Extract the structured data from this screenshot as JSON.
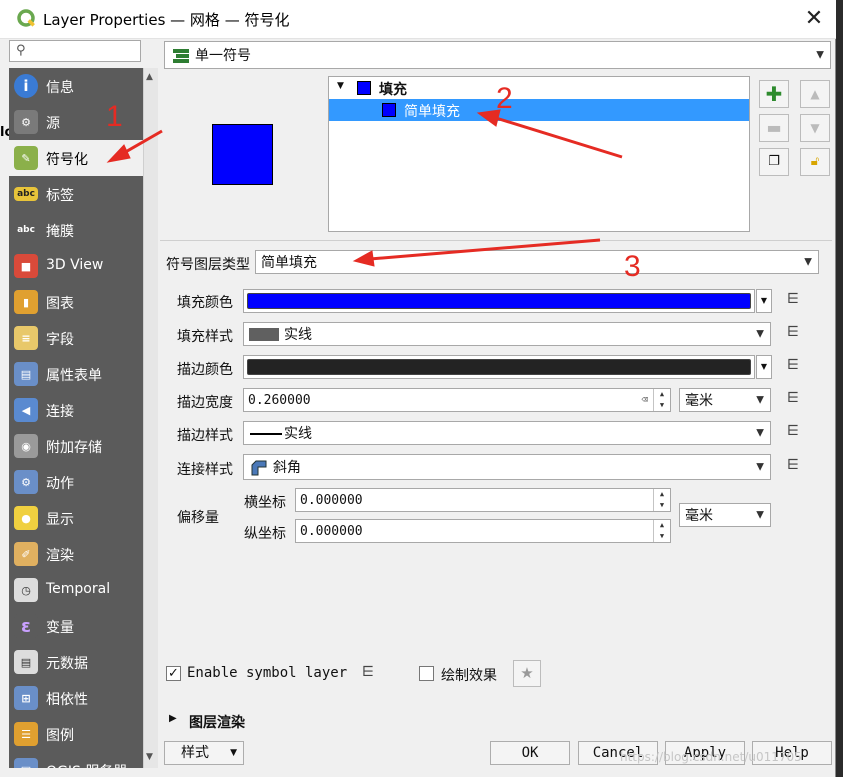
{
  "window": {
    "title": "Layer Properties — 网格 — 符号化",
    "close_glyph": "✕"
  },
  "sidebar": {
    "search_placeholder": "",
    "edge_label": "lo",
    "items": [
      {
        "label": "信息",
        "icon": "info-icon",
        "color": "#3a7bd5"
      },
      {
        "label": "源",
        "icon": "wrench-icon",
        "color": "#7a7a7a"
      },
      {
        "label": "符号化",
        "icon": "paintbrush-icon",
        "color": "#8bb04a"
      },
      {
        "label": "标签",
        "icon": "abc-label-icon",
        "color": "#e8c43a"
      },
      {
        "label": "掩膜",
        "icon": "abc-mask-icon",
        "color": "#5b5b5b"
      },
      {
        "label": "3D View",
        "icon": "cube-icon",
        "color": "#d94a3a"
      },
      {
        "label": "图表",
        "icon": "chart-icon",
        "color": "#e0a030"
      },
      {
        "label": "字段",
        "icon": "fields-icon",
        "color": "#e8c86a"
      },
      {
        "label": "属性表单",
        "icon": "form-icon",
        "color": "#6a8fc8"
      },
      {
        "label": "连接",
        "icon": "join-icon",
        "color": "#5a8ad0"
      },
      {
        "label": "附加存储",
        "icon": "database-icon",
        "color": "#9a9a9a"
      },
      {
        "label": "动作",
        "icon": "gear-action-icon",
        "color": "#6a8fc8"
      },
      {
        "label": "显示",
        "icon": "speech-bubble-icon",
        "color": "#f0d040"
      },
      {
        "label": "渲染",
        "icon": "brush-icon",
        "color": "#e0b060"
      },
      {
        "label": "Temporal",
        "icon": "clock-icon",
        "color": "#dddddd"
      },
      {
        "label": "变量",
        "icon": "epsilon-icon",
        "color": "#5b5b5b"
      },
      {
        "label": "元数据",
        "icon": "document-icon",
        "color": "#dddddd"
      },
      {
        "label": "相依性",
        "icon": "dependency-icon",
        "color": "#6a8fc8"
      },
      {
        "label": "图例",
        "icon": "legend-icon",
        "color": "#e0a030"
      },
      {
        "label": "QGIS 服务器",
        "icon": "server-icon",
        "color": "#6a8fc8"
      }
    ],
    "active_index": 2
  },
  "renderer": {
    "label": "单一符号"
  },
  "symbol_tree": {
    "rows": [
      {
        "label": "填充",
        "expand": "▼"
      },
      {
        "label": "简单填充"
      }
    ]
  },
  "layer_type": {
    "label": "符号图层类型",
    "value": "简单填充"
  },
  "props": {
    "fill_color": {
      "label": "填充颜色",
      "color": "#0000ff"
    },
    "fill_style": {
      "label": "填充样式",
      "value": "实线",
      "swatch": "#606060"
    },
    "stroke_color": {
      "label": "描边颜色",
      "color": "#232323"
    },
    "stroke_width": {
      "label": "描边宽度",
      "value": "0.260000",
      "unit": "毫米"
    },
    "stroke_style": {
      "label": "描边样式",
      "value": "实线"
    },
    "join_style": {
      "label": "连接样式",
      "value": "斜角"
    },
    "offset": {
      "label": "偏移量",
      "x_label": "横坐标",
      "x_value": "0.000000",
      "y_label": "纵坐标",
      "y_value": "0.000000",
      "unit": "毫米"
    }
  },
  "footer": {
    "enable_label": "Enable symbol layer",
    "enable_checked": true,
    "effects_label": "绘制效果",
    "effects_checked": false,
    "render_section": "图层渲染",
    "style_button": "样式",
    "ok": "OK",
    "cancel": "Cancel",
    "apply": "Apply",
    "help": "Help",
    "watermark": "https://blog.csdn.net/u011705"
  },
  "annotations": [
    "1",
    "2",
    "3"
  ]
}
